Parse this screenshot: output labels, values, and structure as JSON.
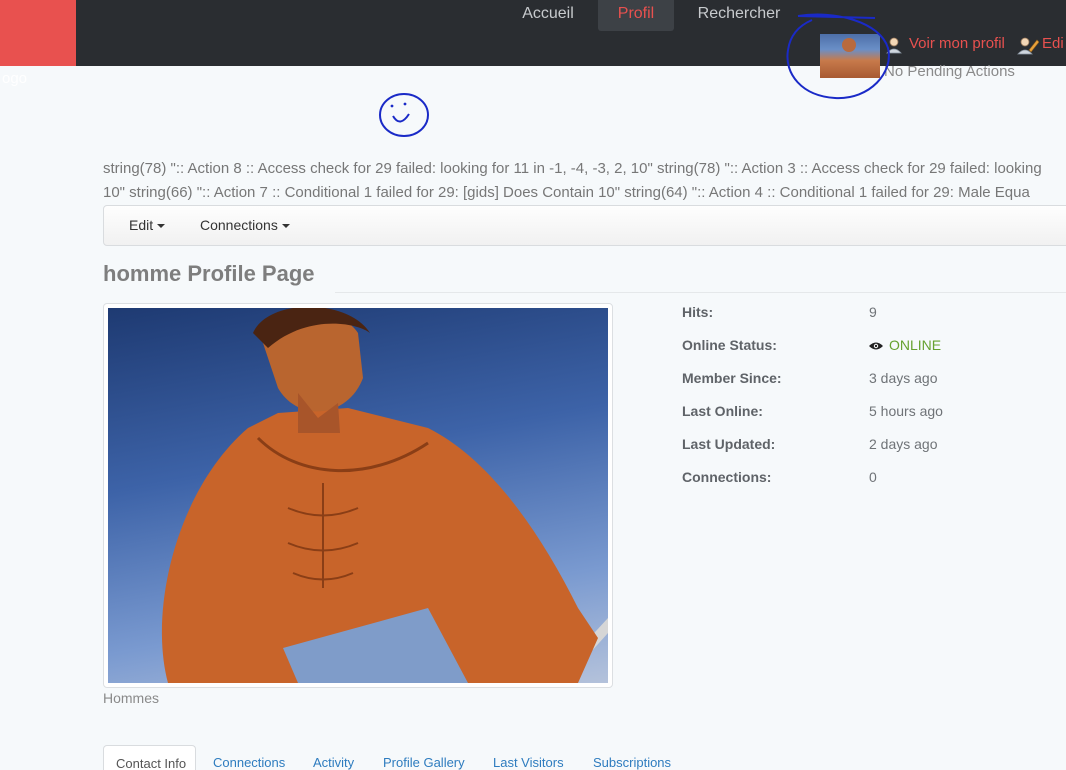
{
  "logo": {
    "text": "ogo"
  },
  "nav": {
    "items": [
      "Accueil",
      "Profil",
      "Rechercher"
    ]
  },
  "user": {
    "view_profile": "Voir mon profil",
    "edit": "Edi",
    "pending": "No Pending Actions"
  },
  "debug": {
    "line1": "string(78) \":: Action 8 :: Access check for 29 failed: looking for 11 in -1, -4, -3, 2, 10\" string(78) \":: Action 3 :: Access check for 29 failed: looking",
    "line2": "10\" string(66) \":: Action 7 :: Conditional 1 failed for 29: [gids] Does Contain 10\" string(64) \":: Action 4 :: Conditional 1 failed for 29: Male Equa"
  },
  "toolbar": {
    "edit_label": "Edit",
    "connections_label": "Connections"
  },
  "profile": {
    "title": "homme Profile Page",
    "photo_caption": "Hommes"
  },
  "info": {
    "rows": [
      {
        "label": "Hits:",
        "value": "9"
      },
      {
        "label": "Online Status:",
        "value": "ONLINE"
      },
      {
        "label": "Member Since:",
        "value": "3 days ago"
      },
      {
        "label": "Last Online:",
        "value": "5 hours ago"
      },
      {
        "label": "Last Updated:",
        "value": "2 days ago"
      },
      {
        "label": "Connections:",
        "value": "0"
      }
    ]
  },
  "tabs": {
    "active": "Contact Info",
    "items": [
      "Connections",
      "Activity",
      "Profile Gallery",
      "Last Visitors",
      "Subscriptions"
    ]
  },
  "colors": {
    "accent": "#e8514f",
    "topbar": "#2a2d31",
    "online": "#66a130",
    "link": "#2e7cbf"
  }
}
